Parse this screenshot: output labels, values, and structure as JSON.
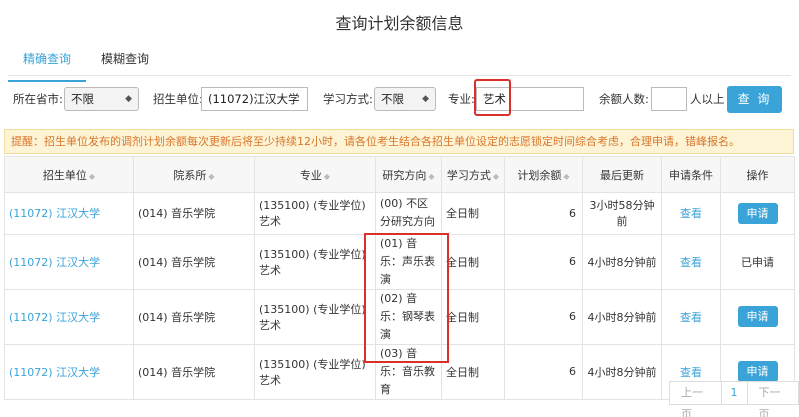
{
  "page_title": "查询计划余额信息",
  "tabs": [
    {
      "label": "精确查询",
      "active": true
    },
    {
      "label": "模糊查询",
      "active": false
    }
  ],
  "filters": {
    "province_label": "所在省市:",
    "province_value": "不限",
    "school_label": "招生单位:",
    "school_value": "(11072)江汉大学",
    "study_mode_label": "学习方式:",
    "study_mode_value": "不限",
    "major_label": "专业:",
    "major_value": "艺术",
    "remain_label": "余额人数:",
    "remain_value": "",
    "remain_suffix": "人以上",
    "query_button": "查 询"
  },
  "notice": "提醒：招生单位发布的调剂计划余额每次更新后将至少持续12小时，请各位考生结合各招生单位设定的志愿锁定时间综合考虑，合理申请，错峰报名。",
  "table": {
    "headers": [
      "招生单位",
      "院系所",
      "专业",
      "研究方向",
      "学习方式",
      "计划余额",
      "最后更新",
      "申请条件",
      "操作"
    ],
    "rows": [
      {
        "school": "(11072) 江汉大学",
        "dept": "(014) 音乐学院",
        "major": "(135100) (专业学位)艺术",
        "direction": "(00) 不区分研究方向",
        "mode": "全日制",
        "remain": "6",
        "updated": "3小时58分钟前",
        "cond": "查看",
        "op": "申请",
        "applied": false
      },
      {
        "school": "(11072) 江汉大学",
        "dept": "(014) 音乐学院",
        "major": "(135100) (专业学位)艺术",
        "direction": "(01) 音乐：声乐表演",
        "mode": "全日制",
        "remain": "6",
        "updated": "4小时8分钟前",
        "cond": "查看",
        "op": "已申请",
        "applied": true
      },
      {
        "school": "(11072) 江汉大学",
        "dept": "(014) 音乐学院",
        "major": "(135100) (专业学位)艺术",
        "direction": "(02) 音乐：钢琴表演",
        "mode": "全日制",
        "remain": "6",
        "updated": "4小时8分钟前",
        "cond": "查看",
        "op": "申请",
        "applied": false
      },
      {
        "school": "(11072) 江汉大学",
        "dept": "(014) 音乐学院",
        "major": "(135100) (专业学位)艺术",
        "direction": "(03) 音乐：音乐教育",
        "mode": "全日制",
        "remain": "6",
        "updated": "4小时8分钟前",
        "cond": "查看",
        "op": "申请",
        "applied": false
      }
    ]
  },
  "pager": {
    "prev": "上一页",
    "current": "1",
    "next": "下一页"
  },
  "colors": {
    "accent": "#3aa3d8",
    "highlight": "#d9302c",
    "notice_text": "#d9772b",
    "notice_bg": "#fdf3d5"
  }
}
